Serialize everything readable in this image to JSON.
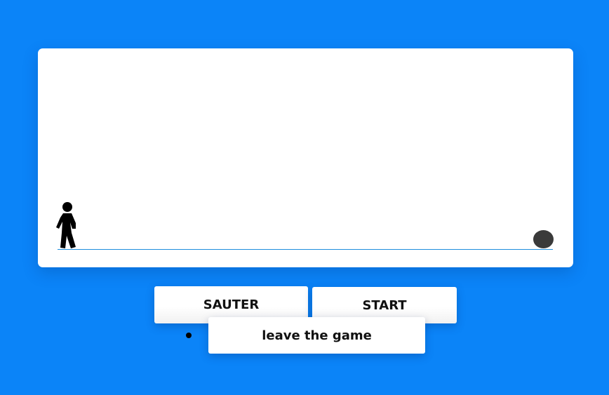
{
  "game": {
    "player_icon": "stick-figure-walking-icon",
    "obstacle_icon": "rolling-ball-icon",
    "colors": {
      "background": "#0b84f8",
      "panel": "#ffffff",
      "ground_line": "#1e8ede",
      "obstacle": "#3a3a3a",
      "player": "#000000"
    }
  },
  "controls": {
    "jump_label": "SAUTER",
    "start_label": "START",
    "leave_label": "leave the game"
  }
}
